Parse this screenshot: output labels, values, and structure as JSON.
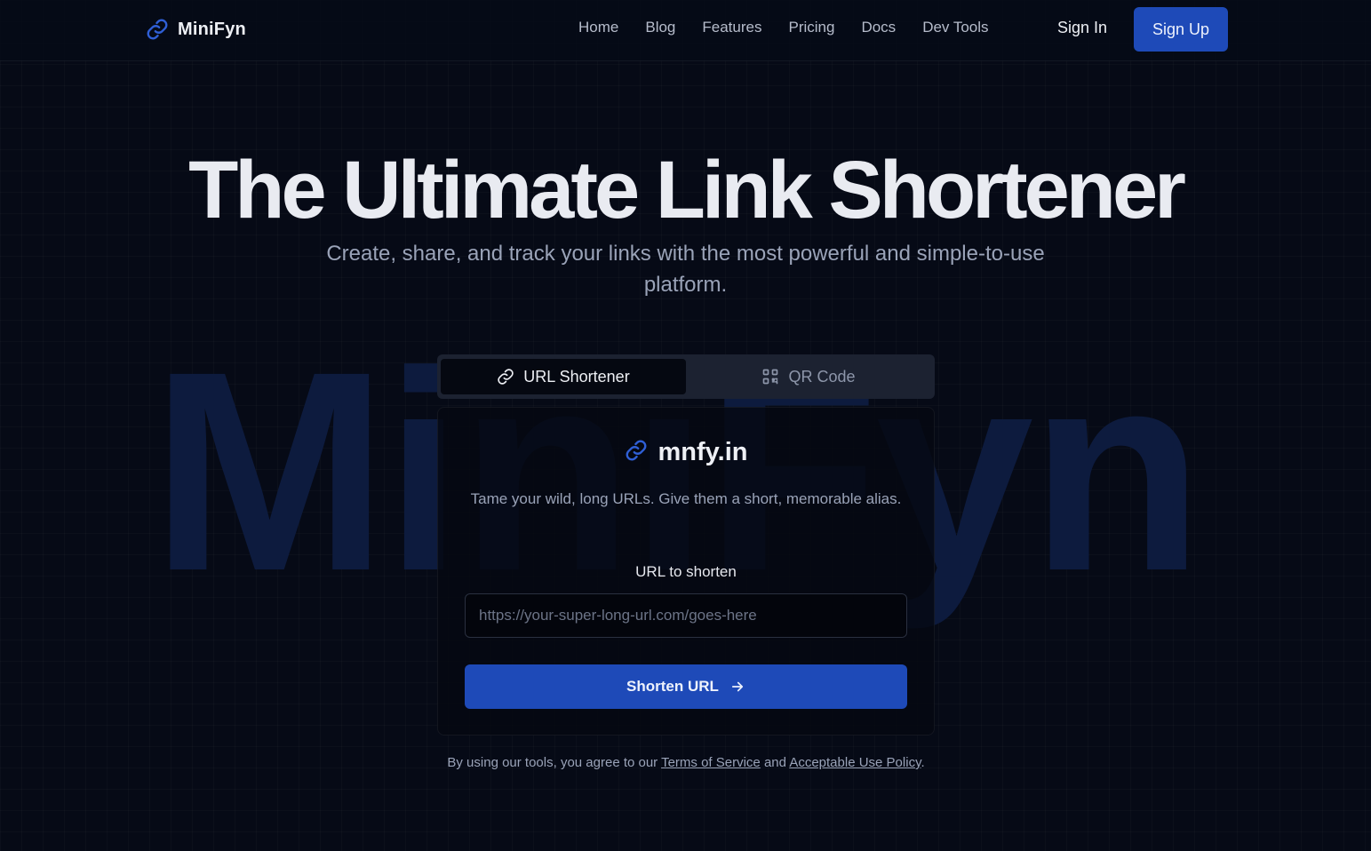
{
  "header": {
    "brand_name": "MiniFyn",
    "brand_icon": "link-icon",
    "nav_items": [
      {
        "label": "Home"
      },
      {
        "label": "Blog"
      },
      {
        "label": "Features"
      },
      {
        "label": "Pricing"
      },
      {
        "label": "Docs"
      },
      {
        "label": "Dev Tools"
      }
    ],
    "signin_label": "Sign In",
    "signup_label": "Sign Up"
  },
  "hero": {
    "title": "The Ultimate Link Shortener",
    "subtitle": "Create, share, and track your links with the most powerful and simple-to-use platform.",
    "watermark": "MiniFyn"
  },
  "tabs": [
    {
      "label": "URL Shortener",
      "icon": "link-icon",
      "active": true
    },
    {
      "label": "QR Code",
      "icon": "qr-code-icon",
      "active": false
    }
  ],
  "card": {
    "brand_name": "mnfy.in",
    "brand_icon": "link-icon",
    "description": "Tame your wild, long URLs. Give them a short, memorable alias.",
    "field_label": "URL to shorten",
    "input_value": "",
    "input_placeholder": "https://your-super-long-url.com/goes-here",
    "button_label": "Shorten URL",
    "button_icon": "arrow-right-icon"
  },
  "legal": {
    "prefix": "By using our tools, you agree to our ",
    "terms_label": "Terms of Service",
    "conjunction": " and ",
    "policy_label": "Acceptable Use Policy",
    "suffix": "."
  },
  "colors": {
    "background": "#060a16",
    "accent": "#1e4ab8",
    "watermark": "#0d1b3e",
    "muted_text": "#9aa3b8"
  }
}
